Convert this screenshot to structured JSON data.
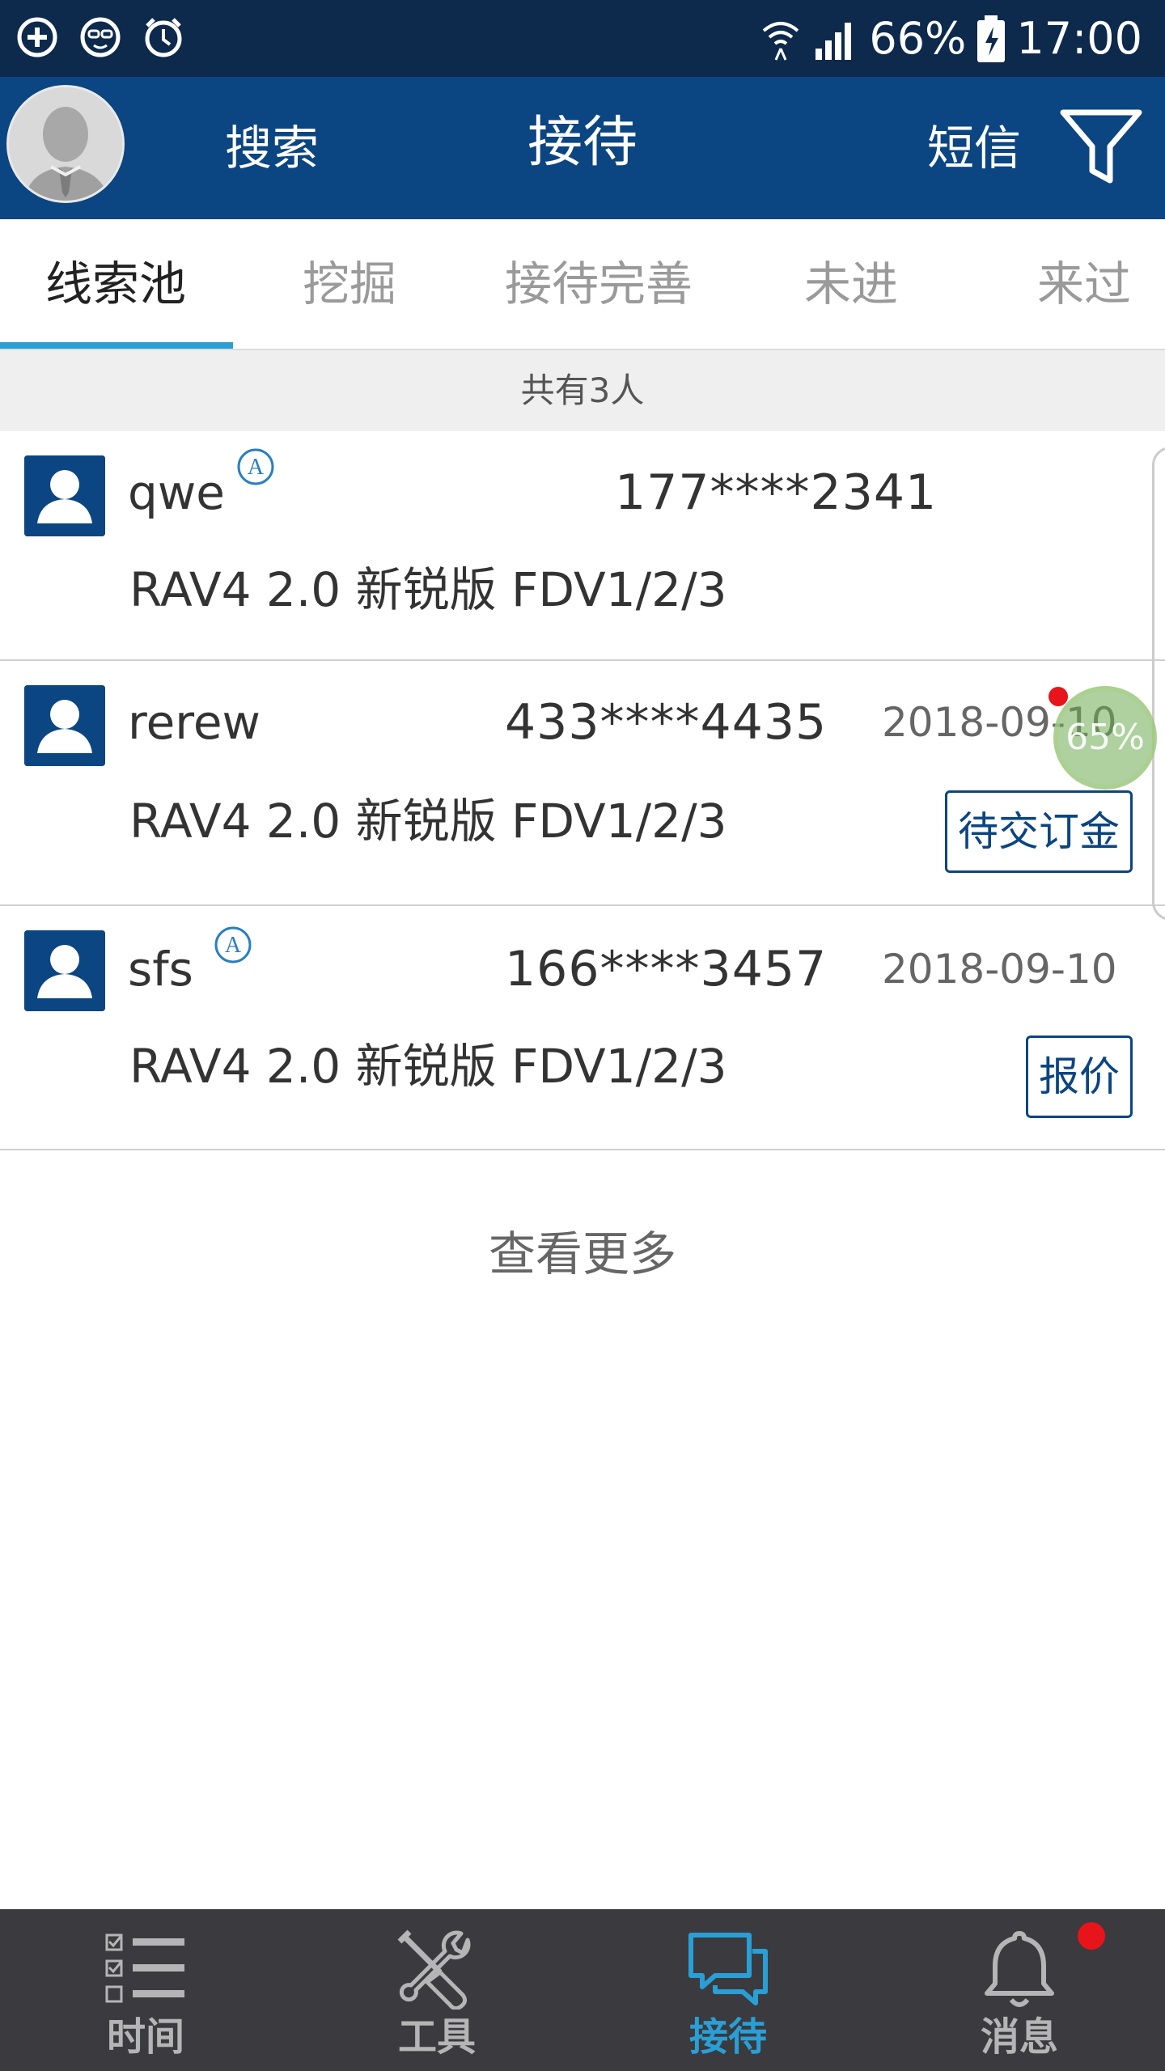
{
  "status_bar": {
    "battery": "66%",
    "time": "17:00",
    "icons": [
      "plus-circle-icon",
      "face-icon",
      "alarm-icon",
      "wifi-icon",
      "signal-icon",
      "battery-charging-icon"
    ]
  },
  "header": {
    "search_label": "搜索",
    "title": "接待",
    "sms_label": "短信",
    "filter_icon": "filter-icon"
  },
  "tabs": [
    {
      "label": "线索池",
      "active": true
    },
    {
      "label": "挖掘",
      "active": false
    },
    {
      "label": "接待完善",
      "active": false
    },
    {
      "label": "未进",
      "active": false
    },
    {
      "label": "来过",
      "active": false
    }
  ],
  "count_text": "共有3人",
  "customers": [
    {
      "name": "qwe",
      "phone": "177****2341",
      "date": "",
      "car": "RAV4 2.0 新锐版 FDV1/2/3",
      "action": "",
      "badge": "A"
    },
    {
      "name": "rerew",
      "phone": "433****4435",
      "date": "2018-09-10",
      "car": "RAV4 2.0 新锐版 FDV1/2/3",
      "action": "待交订金",
      "badge": ""
    },
    {
      "name": "sfs",
      "phone": "166****3457",
      "date": "2018-09-10",
      "car": "RAV4 2.0 新锐版 FDV1/2/3",
      "action": "报价",
      "badge": "A"
    }
  ],
  "floating_widget": "65%",
  "more_label": "查看更多",
  "bottom_nav": [
    {
      "label": "时间",
      "icon": "checklist-icon",
      "active": false
    },
    {
      "label": "工具",
      "icon": "tools-icon",
      "active": false
    },
    {
      "label": "接待",
      "icon": "chat-icon",
      "active": true
    },
    {
      "label": "消息",
      "icon": "bell-icon",
      "active": false
    }
  ],
  "colors": {
    "status_bar": "#0d2a4c",
    "header": "#0b4582",
    "accent": "#2a9fd6",
    "nav_bg": "#3a3a3f",
    "badge_red": "#e8141b"
  }
}
